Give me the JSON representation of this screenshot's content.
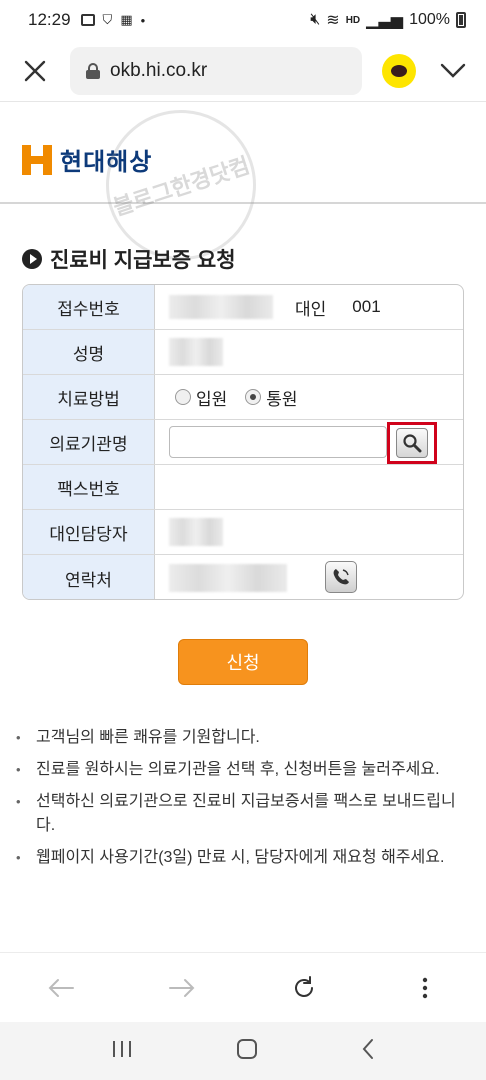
{
  "status_bar": {
    "time": "12:29",
    "network_label": "HD",
    "battery": "100%"
  },
  "browser": {
    "url": "okb.hi.co.kr"
  },
  "header": {
    "logo_text": "현대해상",
    "watermark_text": "블로그한경닷컴"
  },
  "page": {
    "title": "진료비 지급보증 요청"
  },
  "form": {
    "rows": [
      {
        "label": "접수번호",
        "value_extra": "대인",
        "value_code": "001"
      },
      {
        "label": "성명"
      },
      {
        "label": "치료방법",
        "options": [
          "입원",
          "통원"
        ],
        "selected": "통원"
      },
      {
        "label": "의료기관명",
        "input_value": ""
      },
      {
        "label": "팩스번호"
      },
      {
        "label": "대인담당자"
      },
      {
        "label": "연락처"
      }
    ]
  },
  "submit_label": "신청",
  "notes": [
    "고객님의 빠른 쾌유를 기원합니다.",
    "진료를 원하시는 의료기관을 선택 후, 신청버튼을 눌러주세요.",
    "선택하신 의료기관으로 진료비 지급보증서를 팩스로 보내드립니다.",
    "웹페이지 사용기간(3일) 만료 시, 담당자에게 재요청 해주세요."
  ],
  "colors": {
    "brand_orange": "#f7931e",
    "brand_navy": "#0d3a7a",
    "highlight_red": "#d0021b",
    "header_cell_bg": "#e5eefa"
  }
}
